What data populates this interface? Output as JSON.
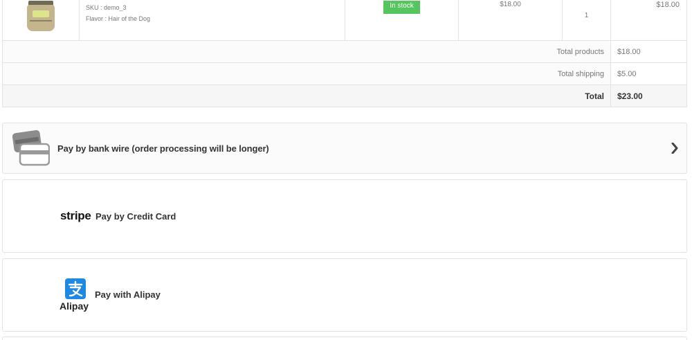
{
  "cart": {
    "product": {
      "sku": "SKU : demo_3",
      "attributes": "Flavor : Hair of the Dog",
      "availability": "In stock",
      "unit_price": "$18.00",
      "quantity": "1",
      "line_total": "$18.00"
    },
    "summary": {
      "total_products_label": "Total products",
      "total_products_value": "$18.00",
      "total_shipping_label": "Total shipping",
      "total_shipping_value": "$5.00",
      "total_label": "Total",
      "total_value": "$23.00"
    }
  },
  "payment": {
    "bankwire": {
      "label": "Pay by bank wire (order processing will be longer)",
      "icon": "credit-card-icon",
      "arrow_icon": "chevron-right-icon"
    },
    "stripe": {
      "logo_text": "stripe",
      "label": "Pay by Credit Card"
    },
    "alipay": {
      "logo_text": "Alipay",
      "label": "Pay with Alipay",
      "icon": "alipay-icon"
    }
  },
  "colors": {
    "in_stock": "#55c65e",
    "border": "#e2e2e2",
    "alipay_blue": "#1e88e5"
  }
}
